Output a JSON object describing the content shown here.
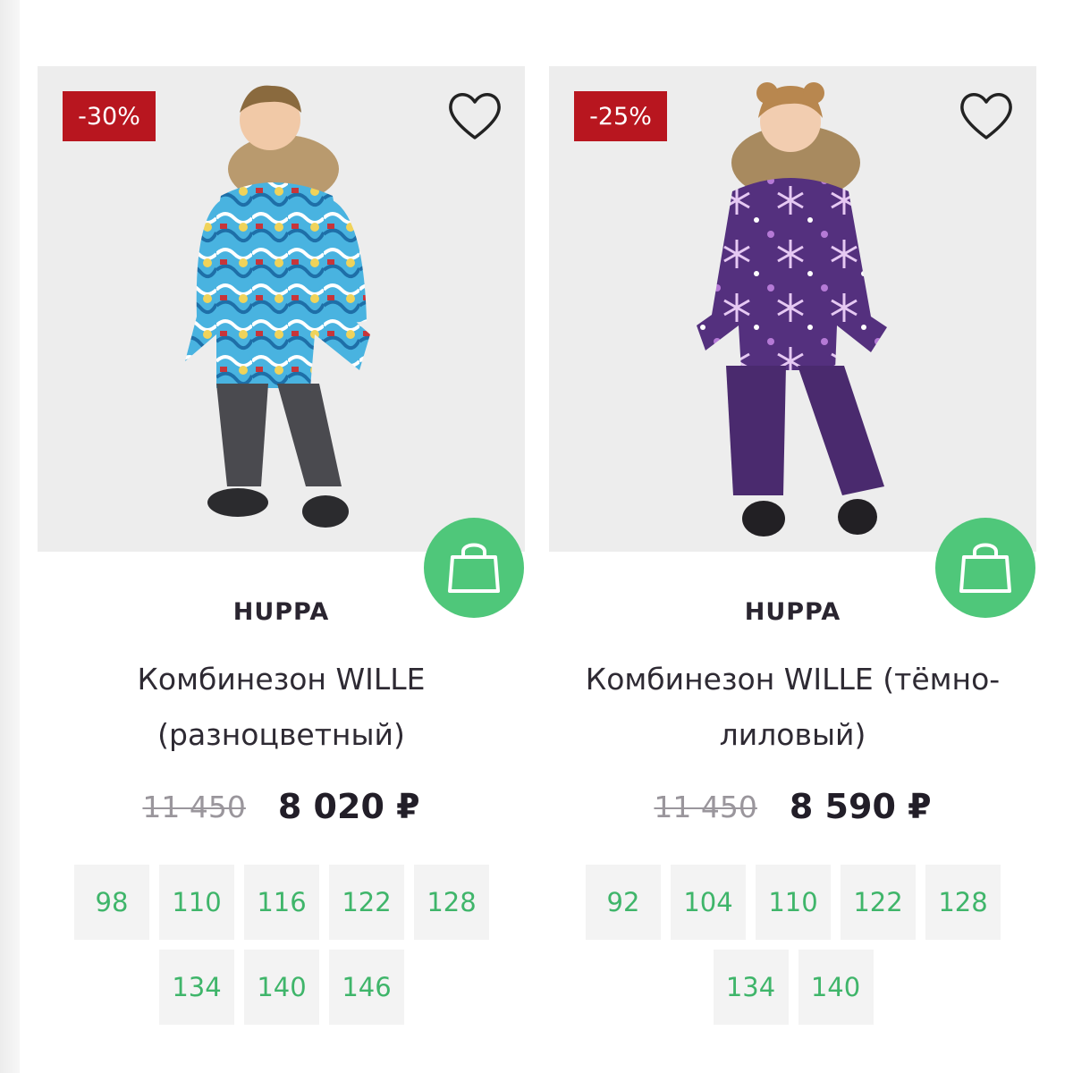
{
  "products": [
    {
      "discount": "-30%",
      "brand": "HUPPA",
      "title": "Комбинезон WILLE (разноцветный)",
      "old_price": "11 450",
      "new_price": "8 020 ₽",
      "sizes": [
        "98",
        "110",
        "116",
        "122",
        "128",
        "134",
        "140",
        "146"
      ],
      "image": {
        "kind": "boy-multicolor-graffiti-jumpsuit",
        "main_color": "#3fa9d8",
        "pants_color": "#4a4a4f"
      }
    },
    {
      "discount": "-25%",
      "brand": "HUPPA",
      "title": "Комбинезон WILLE (тёмно-лиловый)",
      "old_price": "11 450",
      "new_price": "8 590 ₽",
      "sizes": [
        "92",
        "104",
        "110",
        "122",
        "128",
        "134",
        "140"
      ],
      "image": {
        "kind": "girl-purple-snowflake-jumpsuit",
        "main_color": "#54307e",
        "pants_color": "#4a2a6e"
      }
    }
  ],
  "icons": {
    "favorite": "heart-outline-icon",
    "cart": "shopping-bag-icon"
  },
  "colors": {
    "badge": "#b8161f",
    "cart_button": "#4fc77a",
    "size_text": "#3fb56a",
    "photo_bg": "#ededed"
  }
}
